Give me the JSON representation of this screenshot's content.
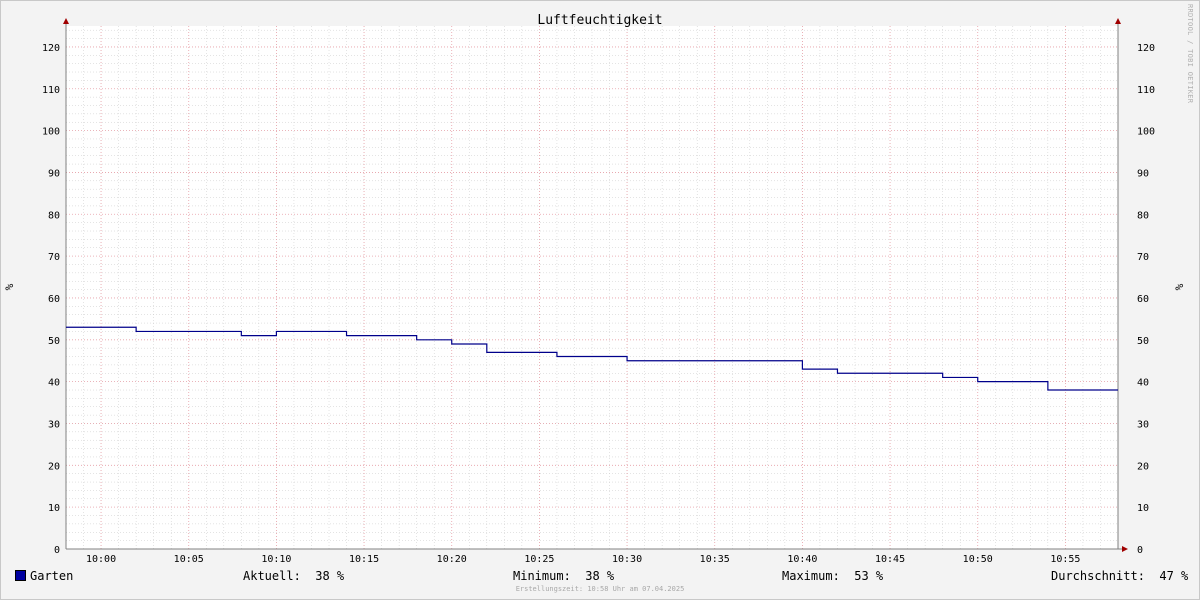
{
  "chart_data": {
    "type": "line",
    "title": "Luftfeuchtigkeit",
    "ylabel": "%",
    "ylim": [
      0,
      125
    ],
    "y_ticks": [
      0,
      10,
      20,
      30,
      40,
      50,
      60,
      70,
      80,
      90,
      100,
      110,
      120
    ],
    "x_range": [
      "09:58",
      "10:58"
    ],
    "x_ticks": [
      "10:00",
      "10:05",
      "10:10",
      "10:15",
      "10:20",
      "10:25",
      "10:30",
      "10:35",
      "10:40",
      "10:45",
      "10:50",
      "10:55"
    ],
    "grid": true,
    "series": [
      {
        "name": "Garten",
        "color": "#00008b",
        "step": true,
        "points": [
          [
            "09:58",
            53
          ],
          [
            "10:02",
            52
          ],
          [
            "10:08",
            51
          ],
          [
            "10:10",
            52
          ],
          [
            "10:14",
            51
          ],
          [
            "10:18",
            50
          ],
          [
            "10:20",
            49
          ],
          [
            "10:22",
            47
          ],
          [
            "10:26",
            46
          ],
          [
            "10:30",
            45
          ],
          [
            "10:40",
            43
          ],
          [
            "10:42",
            42
          ],
          [
            "10:48",
            41
          ],
          [
            "10:50",
            40
          ],
          [
            "10:54",
            38
          ],
          [
            "10:58",
            38
          ]
        ]
      }
    ]
  },
  "legend": {
    "series_name": "Garten",
    "swatch_color": "#0000a0",
    "current": "Aktuell:  38 %",
    "minimum": "Minimum:  38 %",
    "maximum": "Maximum:  53 %",
    "average": "Durchschnitt:  47 %"
  },
  "footer": "Erstellungszeit: 10:58 Uhr am 07.04.2025",
  "watermark": "RRDTOOL / TOBI OETIKER",
  "colors": {
    "major_grid": "#e8a0a8",
    "minor_grid": "#c8c8c8",
    "axis": "#808080",
    "arrow": "#a00000"
  }
}
